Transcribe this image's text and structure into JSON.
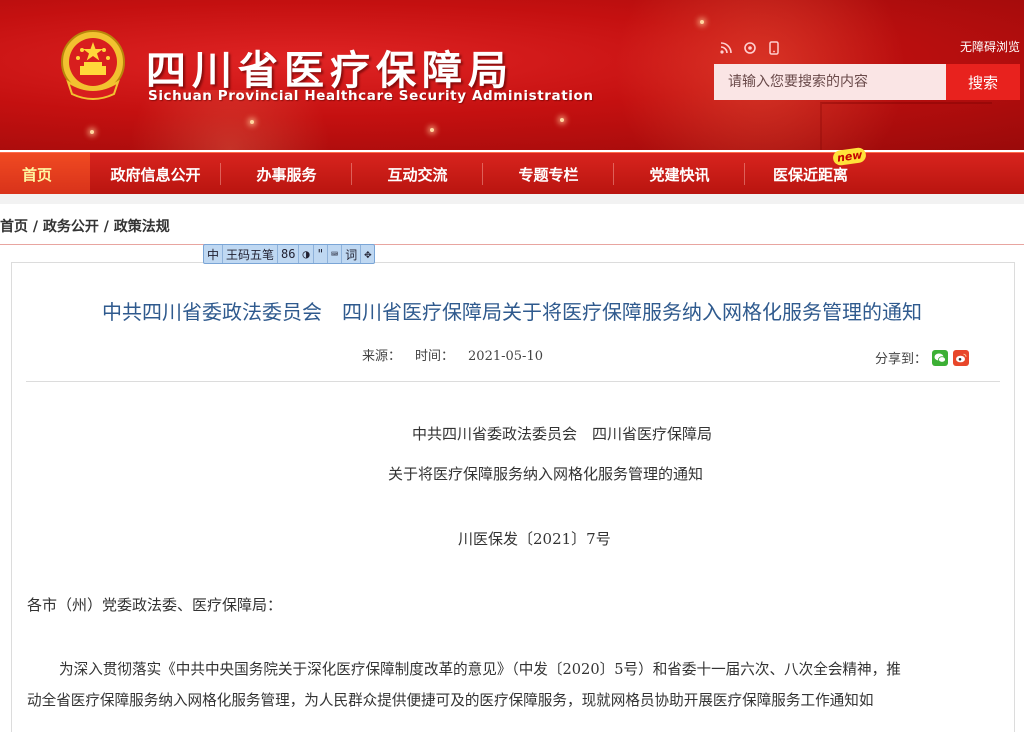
{
  "header": {
    "title": "四川省医疗保障局",
    "subtitle": "Sichuan Provincial Healthcare Security Administration",
    "accessible_label": "无障碍浏览",
    "search_placeholder": "请输入您要搜索的内容",
    "search_button": "搜索",
    "icons": [
      "rss-icon",
      "settings-icon",
      "mobile-icon"
    ]
  },
  "nav": {
    "items": [
      {
        "label": "首页"
      },
      {
        "label": "政府信息公开"
      },
      {
        "label": "办事服务"
      },
      {
        "label": "互动交流"
      },
      {
        "label": "专题专栏"
      },
      {
        "label": "党建快讯"
      },
      {
        "label": "医保近距离"
      }
    ],
    "new_badge": "new"
  },
  "breadcrumb": {
    "items": [
      "首页",
      "政务公开",
      "政策法规"
    ],
    "separator": " / "
  },
  "assist_bar": {
    "items": [
      "中",
      "王码五笔",
      "86",
      "◑",
      "\"",
      "⌨",
      "词",
      "✥"
    ]
  },
  "article": {
    "title": "中共四川省委政法委员会　四川省医疗保障局关于将医疗保障服务纳入网格化服务管理的通知",
    "source_label": "来源：",
    "time_label": "时间：",
    "time_value": "2021-05-10",
    "share_label": "分享到：",
    "issuers": "中共四川省委政法委员会　四川省医疗保障局",
    "doc_heading": "关于将医疗保障服务纳入网格化服务管理的通知",
    "doc_number": "川医保发〔2021〕7号",
    "salutation": "各市（州）党委政法委、医疗保障局：",
    "para1_line1": "为深入贯彻落实《中共中央国务院关于深化医疗保障制度改革的意见》（中发〔2020〕5号）和省委十一届六次、八次全会精神，推",
    "para1_line2": "动全省医疗保障服务纳入网格化服务管理，为人民群众提供便捷可及的医疗保障服务，现就网格员协助开展医疗保障服务工作通知如"
  }
}
